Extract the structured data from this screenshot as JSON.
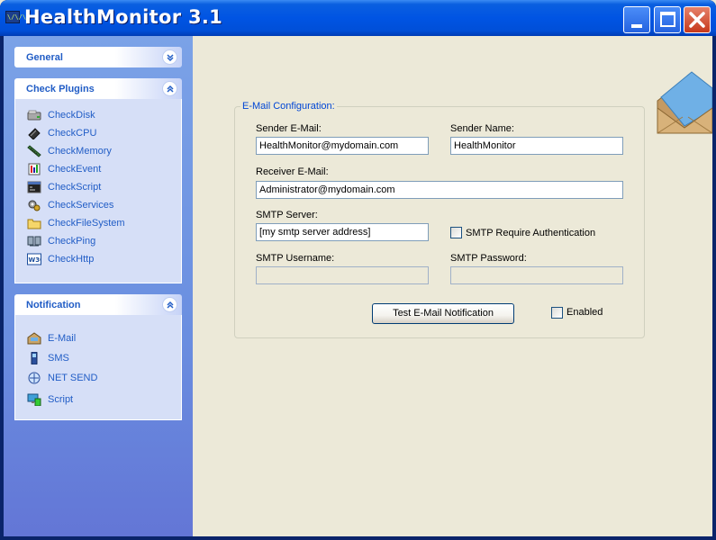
{
  "window": {
    "title": "HealthMonitor 3.1",
    "app_icon_text": "\\/\\/\\"
  },
  "sidebar": {
    "panels": [
      {
        "title": "General",
        "expanded": false,
        "items": []
      },
      {
        "title": "Check Plugins",
        "expanded": true,
        "items": [
          {
            "label": "CheckDisk",
            "icon": "disk-icon"
          },
          {
            "label": "CheckCPU",
            "icon": "cpu-chip-icon"
          },
          {
            "label": "CheckMemory",
            "icon": "memory-stick-icon"
          },
          {
            "label": "CheckEvent",
            "icon": "event-log-icon"
          },
          {
            "label": "CheckScript",
            "icon": "script-icon"
          },
          {
            "label": "CheckServices",
            "icon": "services-gear-icon"
          },
          {
            "label": "CheckFileSystem",
            "icon": "folder-icon"
          },
          {
            "label": "CheckPing",
            "icon": "network-ping-icon"
          },
          {
            "label": "CheckHttp",
            "icon": "w3c-icon"
          }
        ]
      },
      {
        "title": "Notification",
        "expanded": true,
        "items": [
          {
            "label": "E-Mail",
            "icon": "mailbox-icon"
          },
          {
            "label": "SMS",
            "icon": "mobile-phone-icon"
          },
          {
            "label": "NET SEND",
            "icon": "net-send-icon"
          },
          {
            "label": "Script",
            "icon": "script-computer-icon"
          }
        ]
      }
    ]
  },
  "email_config": {
    "group_title": "E-Mail Configuration:",
    "sender_email_label": "Sender E-Mail:",
    "sender_email_value": "HealthMonitor@mydomain.com",
    "sender_name_label": "Sender Name:",
    "sender_name_value": "HealthMonitor",
    "receiver_email_label": "Receiver E-Mail:",
    "receiver_email_value": "Administrator@mydomain.com",
    "smtp_server_label": "SMTP Server:",
    "smtp_server_value": "[my smtp server address]",
    "smtp_auth_label": "SMTP Require Authentication",
    "smtp_auth_checked": false,
    "smtp_username_label": "SMTP Username:",
    "smtp_username_value": "",
    "smtp_password_label": "SMTP Password:",
    "smtp_password_value": "",
    "test_button_label": "Test E-Mail Notification",
    "enabled_label": "Enabled",
    "enabled_checked": false
  },
  "colors": {
    "titlebar": "#0054e3",
    "sidebar": "#6a8ee0",
    "link": "#215dc6",
    "group_title": "#0046d5"
  }
}
